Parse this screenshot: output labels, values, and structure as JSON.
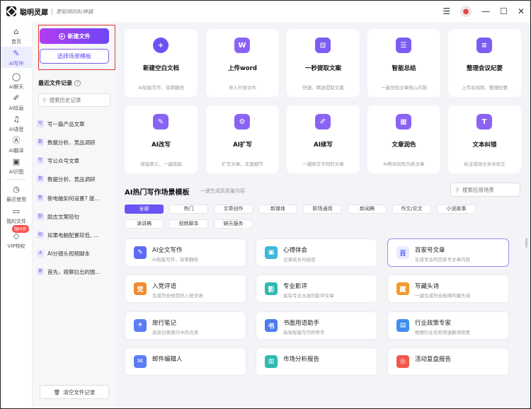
{
  "app": {
    "name": "聪明灵犀",
    "tagline": "更聪明的AI神器"
  },
  "titlebar": {
    "menu_icon": "menu-icon",
    "minimize_icon": "minimize-icon",
    "maximize_icon": "maximize-icon",
    "close_icon": "close-icon"
  },
  "rail": {
    "items": [
      {
        "label": "首页",
        "icon": "home-icon"
      },
      {
        "label": "AI写作",
        "icon": "pen-icon"
      },
      {
        "label": "AI聊天",
        "icon": "chat-icon"
      },
      {
        "label": "AI绘画",
        "icon": "brush-icon"
      },
      {
        "label": "AI语音",
        "icon": "headphone-icon"
      },
      {
        "label": "AI翻译",
        "icon": "translate-icon"
      },
      {
        "label": "AI识图",
        "icon": "image-icon"
      },
      {
        "label": "最近使用",
        "icon": "clock-icon"
      },
      {
        "label": "我的文件",
        "icon": "folder-icon"
      },
      {
        "label": "VIP特权",
        "icon": "diamond-icon"
      }
    ],
    "limited_badge": "限时折"
  },
  "history": {
    "new_doc_label": "新建文件",
    "template_label": "选择场景模板",
    "title": "最近文件记录",
    "search_placeholder": "搜索历史记录",
    "items": [
      {
        "icon": "写",
        "label": "写一篇产品文章"
      },
      {
        "icon": "数",
        "label": "数据分析、竞品调研"
      },
      {
        "icon": "写",
        "label": "写公众号文章"
      },
      {
        "icon": "数",
        "label": "数据分析、竞品调研"
      },
      {
        "icon": "新",
        "label": "新电脑如何设置? 提..."
      },
      {
        "icon": "励",
        "label": "励志文案短句"
      },
      {
        "icon": "如",
        "label": "如果电脑配置较低, ..."
      },
      {
        "icon": "A",
        "label": "AI分镜头视频脚本"
      },
      {
        "icon": "首",
        "label": "首先，观察拉出的图..."
      }
    ],
    "clear_label": "清空文件记录"
  },
  "tools": [
    {
      "name": "新建空白文档",
      "desc": "AI智能写作，效率翻倍",
      "glyph": "+",
      "color": "#6a53f2"
    },
    {
      "name": "上传word",
      "desc": "导入外部文件",
      "glyph": "W",
      "color": "#8a63f5"
    },
    {
      "name": "一秒提取文案",
      "desc": "快速、精准提取文案",
      "glyph": "⊡",
      "color": "#7d5cf3"
    },
    {
      "name": "智能总结",
      "desc": "一键总结文章核心内容",
      "glyph": "☰",
      "color": "#7d5cf3"
    },
    {
      "name": "整理会议纪要",
      "desc": "上传音视频，整理纪要",
      "glyph": "≡",
      "color": "#7d5cf3"
    },
    {
      "name": "AI改写",
      "desc": "保留原义，一键成稿",
      "glyph": "✎",
      "color": "#8a63f5"
    },
    {
      "name": "AI扩写",
      "desc": "扩写文章，丰富细节",
      "glyph": "⚙",
      "color": "#8a63f5"
    },
    {
      "name": "AI续写",
      "desc": "一键续写不同的文章",
      "glyph": "✐",
      "color": "#8a63f5"
    },
    {
      "name": "文章润色",
      "desc": "AI帮你润色为新文章",
      "glyph": "▦",
      "color": "#8a63f5"
    },
    {
      "name": "文本纠错",
      "desc": "标注错误文本并修正",
      "glyph": "T",
      "color": "#8a63f5"
    }
  ],
  "templates": {
    "title": "AI热门写作场景模板",
    "subtitle": "一键生成高质量内容",
    "search_placeholder": "搜索应用场景",
    "categories": [
      "全部",
      "热门",
      "文章创作",
      "新媒体",
      "职场通用",
      "新闻稿",
      "作文/论文",
      "小说故事",
      "演讲稿",
      "视频脚本",
      "娱乐服务"
    ],
    "cards": [
      {
        "name": "AI全文写作",
        "desc": "AI智能写作，效率翻倍",
        "glyph": "✎",
        "color": "#5b6cf5"
      },
      {
        "name": "心得体会",
        "desc": "记录成长与经验",
        "glyph": "▣",
        "color": "#3fb7d8"
      },
      {
        "name": "百家号文章",
        "desc": "生成专业的百家号文章内容",
        "glyph": "百",
        "color": "#e9ecff"
      },
      {
        "name": "入党评语",
        "desc": "生成符合规范的入党评语",
        "glyph": "党",
        "color": "#f2892f"
      },
      {
        "name": "专业影评",
        "desc": "具有专业水准的影评文章",
        "glyph": "影",
        "color": "#2fb9b0"
      },
      {
        "name": "写藏头诗",
        "desc": "一键生成符合格律的藏头诗",
        "glyph": "藏",
        "color": "#f09a2f"
      },
      {
        "name": "旅行笔记",
        "desc": "高效记录旅行中的点滴",
        "glyph": "✈",
        "color": "#5b7cf5"
      },
      {
        "name": "书面用语助手",
        "desc": "高效智能写作好帮手",
        "glyph": "书",
        "color": "#4b7cf0"
      },
      {
        "name": "行业政策专家",
        "desc": "根据行业名称快速解读政策",
        "glyph": "▤",
        "color": "#3f8ef0"
      },
      {
        "name": "邮件编辑人",
        "desc": "",
        "glyph": "✉",
        "color": "#5b7cf5"
      },
      {
        "name": "市场分析报告",
        "desc": "",
        "glyph": "▥",
        "color": "#2fb9b0"
      },
      {
        "name": "活动复盘报告",
        "desc": "",
        "glyph": "◎",
        "color": "#f0594b"
      }
    ]
  }
}
